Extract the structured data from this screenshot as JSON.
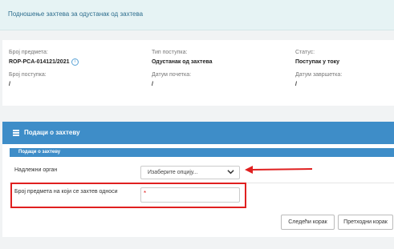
{
  "banner": {
    "title": "Подношење захтева за одустанак од захтева"
  },
  "info": {
    "case_number_label": "Број предмета:",
    "case_number_value": "ROP-PCA-014121/2021",
    "procedure_type_label": "Тип поступка:",
    "procedure_type_value": "Одустанак од захтева",
    "status_label": "Статус:",
    "status_value": "Поступак у току",
    "procedure_number_label": "Број поступка:",
    "procedure_number_value": "/",
    "start_date_label": "Датум почетка:",
    "start_date_value": "/",
    "end_date_label": "Датум завршетка:",
    "end_date_value": "/"
  },
  "panel": {
    "title": "Подаци о захтеву",
    "subheader": "Подаци о захтеву",
    "authority_label": "Надлежни орган",
    "authority_select_value": "Изаберите опцију...",
    "case_ref_label": "Број предмета на који се захтев односи",
    "required_marker": "*"
  },
  "buttons": {
    "next": "Следећи корак",
    "previous": "Претходни корак"
  },
  "colors": {
    "accent": "#3e8dc8",
    "annotation": "#e02020",
    "banner": "#e6f3f4"
  },
  "icons": [
    "help-icon",
    "menu-icon",
    "chevron-down-icon",
    "arrow-left-icon"
  ]
}
